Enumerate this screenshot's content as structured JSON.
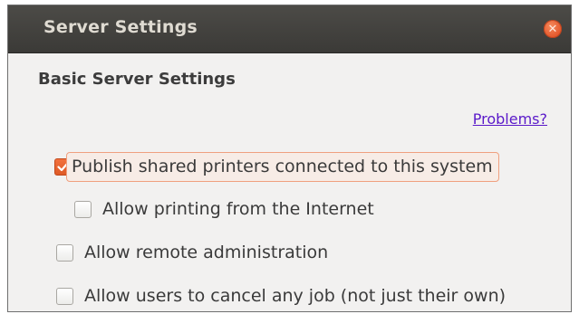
{
  "window": {
    "title": "Server Settings",
    "close_icon": "close-icon"
  },
  "section": {
    "title": "Basic Server Settings"
  },
  "problems_link": "Problems?",
  "options": [
    {
      "label": "Publish shared printers connected to this system",
      "checked": true
    },
    {
      "label": "Allow printing from the Internet",
      "checked": false
    },
    {
      "label": "Allow remote administration",
      "checked": false
    },
    {
      "label": "Allow users to cancel any job (not just their own)",
      "checked": false
    }
  ],
  "colors": {
    "accent": "#e8602c",
    "link": "#5a19c9",
    "titlebar": "#44433f"
  }
}
